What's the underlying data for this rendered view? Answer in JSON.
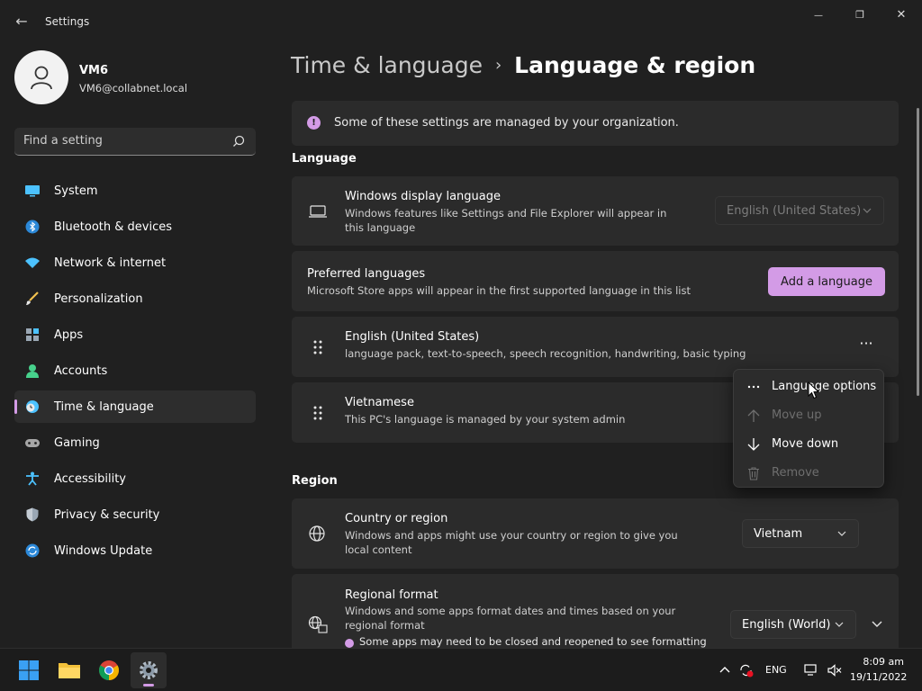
{
  "window": {
    "title": "Settings",
    "back_glyph": "←",
    "min_glyph": "—",
    "max_glyph": "❐",
    "close_glyph": "✕"
  },
  "user": {
    "name": "VM6",
    "email": "VM6@collabnet.local"
  },
  "search": {
    "placeholder": "Find a setting"
  },
  "sidebar": {
    "items": [
      {
        "label": "System",
        "icon": "system-icon"
      },
      {
        "label": "Bluetooth & devices",
        "icon": "bluetooth-icon"
      },
      {
        "label": "Network & internet",
        "icon": "wifi-icon"
      },
      {
        "label": "Personalization",
        "icon": "brush-icon"
      },
      {
        "label": "Apps",
        "icon": "apps-icon"
      },
      {
        "label": "Accounts",
        "icon": "accounts-icon"
      },
      {
        "label": "Time & language",
        "icon": "clock-globe-icon",
        "active": true
      },
      {
        "label": "Gaming",
        "icon": "gamepad-icon"
      },
      {
        "label": "Accessibility",
        "icon": "accessibility-icon"
      },
      {
        "label": "Privacy & security",
        "icon": "shield-icon"
      },
      {
        "label": "Windows Update",
        "icon": "update-icon"
      }
    ]
  },
  "breadcrumb": {
    "parent": "Time & language",
    "separator": "›",
    "current": "Language & region"
  },
  "notice": {
    "icon_glyph": "!",
    "text": "Some of these settings are managed by your organization."
  },
  "language_section": {
    "title": "Language",
    "display_language": {
      "title": "Windows display language",
      "description": "Windows features like Settings and File Explorer will appear in this language",
      "value": "English (United States)"
    },
    "preferred": {
      "title": "Preferred languages",
      "description": "Microsoft Store apps will appear in the first supported language in this list",
      "add_button": "Add a language"
    },
    "languages": [
      {
        "name": "English (United States)",
        "features": "language pack, text-to-speech, speech recognition, handwriting, basic typing"
      },
      {
        "name": "Vietnamese",
        "features": "This PC's language is managed by your system admin"
      }
    ],
    "more_glyph": "···"
  },
  "context_menu": {
    "items": [
      {
        "label": "Language options",
        "icon": "more-horizontal-icon",
        "disabled": false
      },
      {
        "label": "Move up",
        "icon": "arrow-up-icon",
        "disabled": true
      },
      {
        "label": "Move down",
        "icon": "arrow-down-icon",
        "disabled": false
      },
      {
        "label": "Remove",
        "icon": "trash-icon",
        "disabled": true
      }
    ]
  },
  "region_section": {
    "title": "Region",
    "country": {
      "title": "Country or region",
      "description": "Windows and apps might use your country or region to give you local content",
      "value": "Vietnam"
    },
    "format": {
      "title": "Regional format",
      "description": "Windows and some apps format dates and times based on your regional format",
      "value": "English (World)",
      "note": "Some apps may need to be closed and reopened to see formatting"
    }
  },
  "taskbar": {
    "language": "ENG",
    "time": "8:09 am",
    "date": "19/11/2022"
  },
  "colors": {
    "accent": "#d39be6",
    "background": "#202020",
    "card": "#2b2b2b"
  }
}
